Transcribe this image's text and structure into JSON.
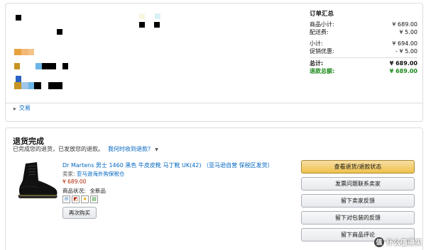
{
  "order_summary": {
    "title": "订单汇总",
    "rows": [
      {
        "label": "商品小计:",
        "value": "¥ 689.00"
      },
      {
        "label": "配送费:",
        "value": "¥ 5.00"
      },
      {
        "label": "小计:",
        "value": "¥ 694.00"
      },
      {
        "label": "促销优惠:",
        "value": "- ¥ 5.00"
      },
      {
        "label": "总计:",
        "value": "¥ 689.00"
      },
      {
        "label": "退款总额:",
        "value": "¥ 689.00"
      }
    ]
  },
  "trade_link": "交易",
  "return": {
    "title": "退货完成",
    "subtitle": "已完成您的退货，已发放您的退款。",
    "when_link": "我何时收到退款?"
  },
  "product": {
    "title": "Dr Martens 男士 1460 黑色 牛皮皮靴 马丁靴 UK(42) （亚马逊自营 保税区发货）",
    "seller_label": "卖家:",
    "seller_name": "亚马逊海外购保税仓",
    "price": "¥ 689.00",
    "condition_label": "商品状况:",
    "condition_value": "全新品",
    "buy_again": "再次购买"
  },
  "actions": [
    "查看退货/退款状态",
    "发票问题联系卖家",
    "留下卖家反馈",
    "留下对包装的反馈",
    "留下商品评论"
  ],
  "watermark": {
    "text": "什么值得买",
    "badge": "值"
  },
  "colors": {
    "link": "#0066c0",
    "price": "#b12704",
    "refund": "#1c8a1c",
    "primary_button": "#f0c14b"
  }
}
